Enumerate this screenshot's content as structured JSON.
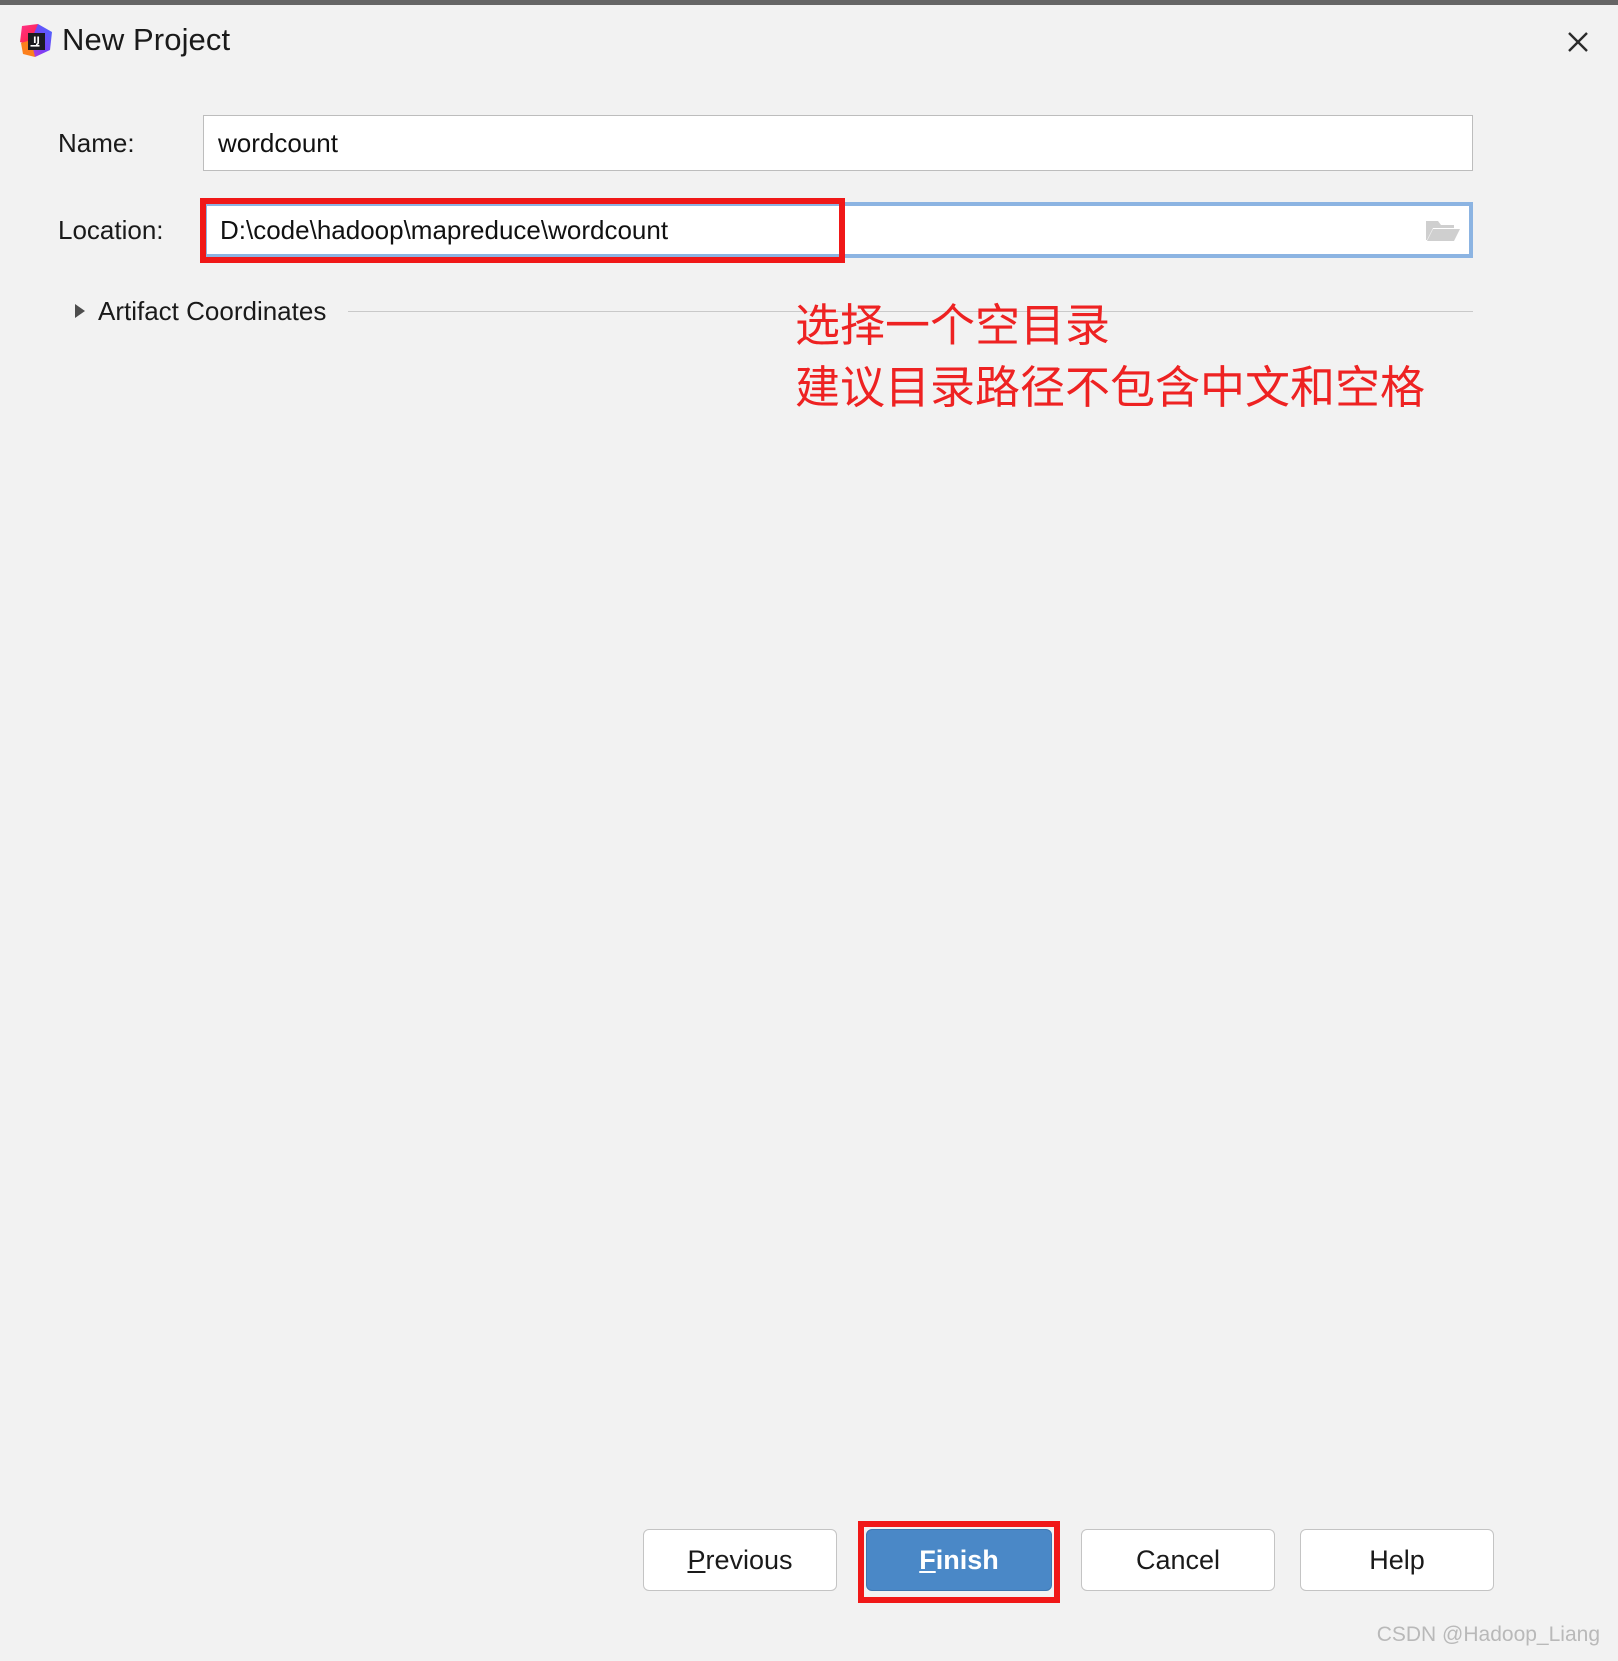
{
  "window": {
    "title": "New Project",
    "app_icon": "intellij-idea-icon",
    "close_icon": "close-icon"
  },
  "form": {
    "name": {
      "label": "Name:",
      "value": "wordcount",
      "placeholder": ""
    },
    "location": {
      "label": "Location:",
      "value": "D:\\code\\hadoop\\mapreduce\\wordcount",
      "placeholder": "",
      "browse_icon": "folder-open-icon"
    }
  },
  "artifact": {
    "label": "Artifact Coordinates",
    "expanded": false,
    "arrow_icon": "triangle-right-icon"
  },
  "annotation": {
    "line1": "选择一个空目录",
    "line2": "建议目录路径不包含中文和空格",
    "color": "#ee2222"
  },
  "buttons": {
    "previous": {
      "mnemonic": "P",
      "rest": "revious"
    },
    "finish": {
      "mnemonic": "F",
      "rest": "inish"
    },
    "cancel": {
      "label": "Cancel"
    },
    "help": {
      "label": "Help"
    }
  },
  "highlights": {
    "color": "#f01818",
    "targets": [
      "location-field",
      "finish-button"
    ]
  },
  "watermark": {
    "text": "CSDN @Hadoop_Liang"
  },
  "colors": {
    "dialog_background": "#f2f2f2",
    "input_background": "#ffffff",
    "focus_border": "#8cb4e2",
    "primary_button": "#4a88c7",
    "annotation_red": "#ee2222",
    "highlight_red": "#f01818"
  }
}
